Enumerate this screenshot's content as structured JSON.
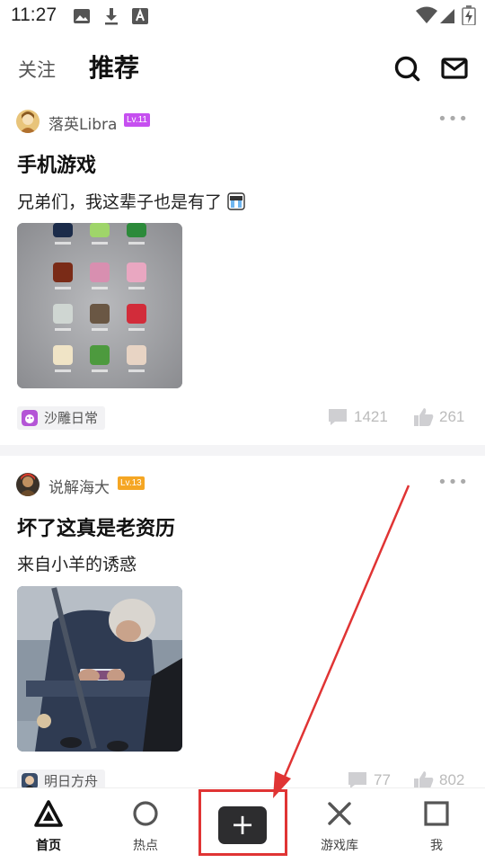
{
  "status_bar": {
    "time": "11:27",
    "icons_left": [
      "image-icon",
      "download-icon",
      "text-a-icon"
    ],
    "icons_right": [
      "wifi-icon",
      "cellular-signal-icon",
      "battery-charging-icon"
    ]
  },
  "header": {
    "tabs": [
      {
        "label": "关注",
        "active": false
      },
      {
        "label": "推荐",
        "active": true
      }
    ],
    "icons": [
      "search-icon",
      "mail-icon"
    ]
  },
  "feed": [
    {
      "author": "落英Libra",
      "level": "Lv.11",
      "level_color": "#c64ff0",
      "title": "手机游戏",
      "text": "兄弟们，我这辈子也是有了",
      "emoji": "crying-face-emoji",
      "image": "phone-home-screen-game-icons",
      "topic": "沙雕日常",
      "comments": "1421",
      "likes": "261"
    },
    {
      "author": "说解海大",
      "level": "Lv.13",
      "level_color": "#f5a623",
      "title": "坏了这真是老资历",
      "text": "来自小羊的诱惑",
      "image": "elderly-man-playing-phone-on-subway",
      "topic": "明日方舟",
      "comments": "77",
      "likes": "802"
    }
  ],
  "bottom_nav": {
    "items": [
      {
        "label": "首页",
        "icon": "home-triangle-icon",
        "active": true
      },
      {
        "label": "热点",
        "icon": "circle-icon",
        "active": false
      },
      {
        "label": "",
        "icon": "plus-icon",
        "active": false
      },
      {
        "label": "游戏库",
        "icon": "x-icon",
        "active": false
      },
      {
        "label": "我",
        "icon": "square-icon",
        "active": false
      }
    ]
  },
  "post_button_symbol": "+",
  "annotation": {
    "color": "#e03434"
  }
}
